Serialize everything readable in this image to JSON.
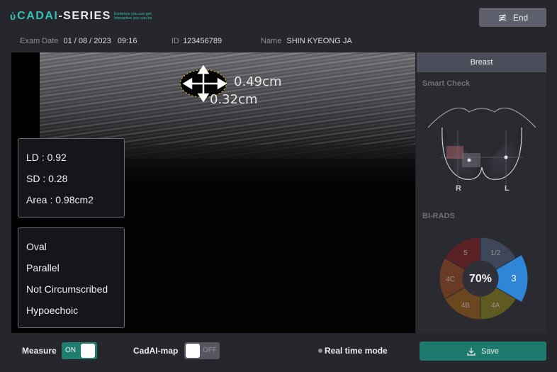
{
  "brand": {
    "logo_text_accent": "CADAI",
    "logo_text_rest": "-SERIES",
    "tagline_1": "Evidence you can get,",
    "tagline_2": "Interactive you can be"
  },
  "header": {
    "end_label": "End"
  },
  "exam": {
    "date_label": "Exam Date",
    "date_value": "01 / 08 / 2023   09:16",
    "id_label": "ID",
    "id_value": "123456789",
    "name_label": "Name",
    "name_value": "SHIN KYEONG JA"
  },
  "image": {
    "measure_long": "0.49cm",
    "measure_short": "0.32cm"
  },
  "metrics": {
    "ld": "LD : 0.92",
    "sd": "SD : 0.28",
    "area": "Area : 0.98cm2"
  },
  "features": [
    "Oval",
    "Parallel",
    "Not Circumscribed",
    "Hypoechoic"
  ],
  "side": {
    "tab": "Breast",
    "smart_check": "Smart Check",
    "right_label": "R",
    "left_label": "L",
    "birads_title": "BI-RADS",
    "center_percent": "70%",
    "segments": [
      {
        "label": "1/2",
        "color": "#3e4659"
      },
      {
        "label": "3",
        "color": "#2f85d6",
        "selected": true
      },
      {
        "label": "4A",
        "color": "#5f5a22"
      },
      {
        "label": "4B",
        "color": "#6b4720"
      },
      {
        "label": "4C",
        "color": "#6a3b24"
      },
      {
        "label": "5",
        "color": "#5a2226"
      }
    ]
  },
  "footer": {
    "measure_label": "Measure",
    "measure_state": "ON",
    "cadai_map_label": "CadAI-map",
    "cadai_map_state": "OFF",
    "realtime_label": "Real time mode",
    "save_label": "Save"
  },
  "colors": {
    "accent": "#2ec4b6",
    "save": "#1e7a6c",
    "selected_segment": "#2f85d6"
  }
}
